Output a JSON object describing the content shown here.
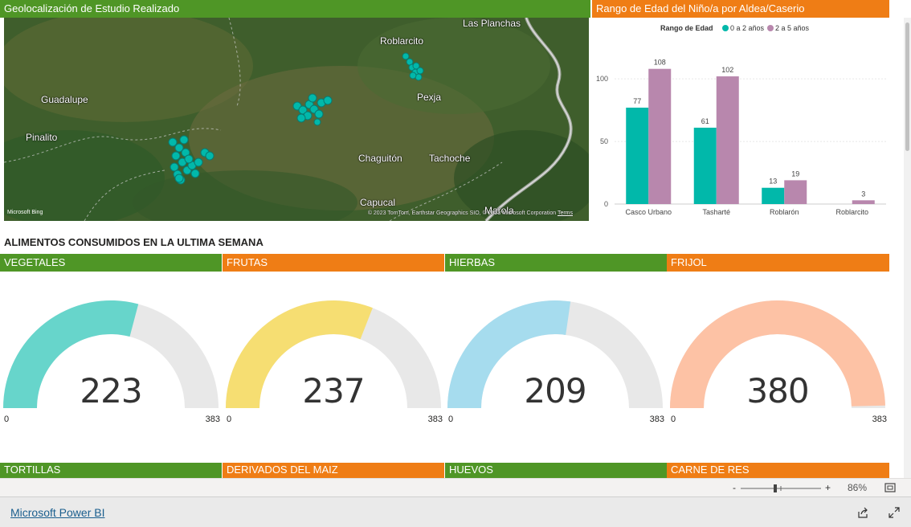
{
  "map": {
    "title": "Geolocalización de Estudio Realizado",
    "places": [
      "Las Planchas",
      "Roblarcito",
      "Guadalupe",
      "Pexja",
      "Pinalito",
      "Chaguitón",
      "Tachoche",
      "Capucal",
      "Marola"
    ],
    "bing_label": "Microsoft Bing",
    "copyright": "© 2023 TomTom, Earthstar Geographics SIO, © 2023 Microsoft Corporation",
    "terms": "Terms"
  },
  "chart_panel": {
    "title": "Rango de Edad del Niño/a por Aldea/Caserio"
  },
  "chart_data": {
    "type": "bar",
    "legend_title": "Rango de Edad",
    "categories": [
      "Casco Urbano",
      "Tasharté",
      "Roblarón",
      "Roblarcito"
    ],
    "series": [
      {
        "name": "0 a 2 años",
        "color": "#01b8aa",
        "values": [
          77,
          61,
          13,
          null
        ]
      },
      {
        "name": "2 a 5 años",
        "color": "#b887ad",
        "values": [
          108,
          102,
          19,
          3
        ]
      }
    ],
    "yticks": [
      0,
      50,
      100
    ],
    "ylim": [
      0,
      120
    ],
    "legend_position": "top"
  },
  "section": {
    "title": "ALIMENTOS CONSUMIDOS EN LA ULTIMA SEMANA"
  },
  "gauges": [
    {
      "label": "VEGETALES",
      "value": 223,
      "value_text": "223",
      "min": "0",
      "max": "383",
      "max_value": 383,
      "color": "#67d5cb",
      "header": "green"
    },
    {
      "label": "FRUTAS",
      "value": 237,
      "value_text": "237",
      "min": "0",
      "max": "383",
      "max_value": 383,
      "color": "#f6de72",
      "header": "orange"
    },
    {
      "label": "HIERBAS",
      "value": 209,
      "value_text": "209",
      "min": "0",
      "max": "383",
      "max_value": 383,
      "color": "#a6dcee",
      "header": "green"
    },
    {
      "label": "FRIJOL",
      "value": 380,
      "value_text": "380",
      "min": "0",
      "max": "383",
      "max_value": 383,
      "color": "#fdc2a5",
      "header": "orange"
    }
  ],
  "bottom_headers": [
    "TORTILLAS",
    "DERIVADOS DEL MAIZ",
    "HUEVOS",
    "CARNE DE RES"
  ],
  "zoom": {
    "minus": "-",
    "plus": "+",
    "level": "86%"
  },
  "footer": {
    "link": "Microsoft Power BI"
  }
}
